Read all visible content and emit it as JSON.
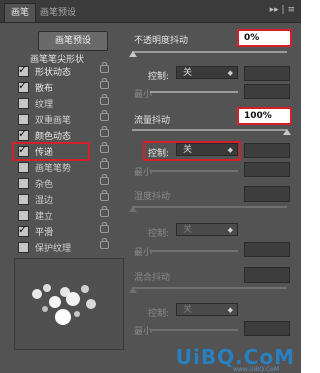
{
  "tabs": [
    {
      "label": "画笔"
    },
    {
      "label": "画笔预设"
    }
  ],
  "panel_menu_icons": "▸▸ | ≡",
  "brush_presets_button": "画笔预设",
  "brush_tip_shape_label": "画笔笔尖形状",
  "options": [
    {
      "label": "形状动态",
      "checked": true,
      "locked": true
    },
    {
      "label": "散布",
      "checked": true,
      "locked": true
    },
    {
      "label": "纹理",
      "checked": false,
      "locked": true
    },
    {
      "label": "双重画笔",
      "checked": false,
      "locked": true
    },
    {
      "label": "颜色动态",
      "checked": true,
      "locked": true
    },
    {
      "label": "传递",
      "checked": true,
      "locked": true,
      "highlighted": true
    },
    {
      "label": "画笔笔势",
      "checked": false,
      "locked": true
    },
    {
      "label": "杂色",
      "checked": false,
      "locked": true
    },
    {
      "label": "湿边",
      "checked": false,
      "locked": true
    },
    {
      "label": "建立",
      "checked": false,
      "locked": true
    },
    {
      "label": "平滑",
      "checked": true,
      "locked": true
    },
    {
      "label": "保护纹理",
      "checked": false,
      "locked": true
    }
  ],
  "opacity_jitter": {
    "label": "不透明度抖动",
    "value": "0%"
  },
  "control_1": {
    "label": "控制:",
    "value": "关"
  },
  "min_1": {
    "label": "最小"
  },
  "flow_jitter": {
    "label": "流量抖动",
    "value": "100%"
  },
  "control_2": {
    "label": "控制:",
    "value": "关"
  },
  "min_2": {
    "label": "最小"
  },
  "wetness_jitter": {
    "label": "湿度抖动"
  },
  "control_3": {
    "label": "控制:",
    "value": "关"
  },
  "min_3": {
    "label": "最小"
  },
  "mix_jitter": {
    "label": "混合抖动"
  },
  "control_4": {
    "label": "控制:",
    "value": "关"
  },
  "min_4": {
    "label": "最小"
  },
  "watermark": {
    "text": "UiBQ.CoM",
    "sub": "www.UiBQ.CoM"
  }
}
